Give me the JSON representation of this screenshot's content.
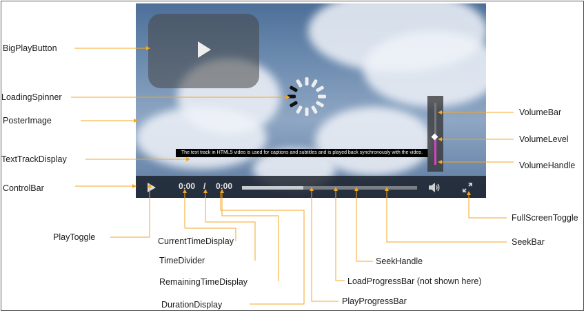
{
  "labels": {
    "big_play_button": "BigPlayButton",
    "loading_spinner": "LoadingSpinner",
    "poster_image": "PosterImage",
    "text_track_display": "TextTrackDisplay",
    "control_bar": "ControlBar",
    "play_toggle": "PlayToggle",
    "current_time_display": "CurrentTimeDisplay",
    "time_divider": "TimeDivider",
    "remaining_time_display": "RemainingTimeDisplay",
    "duration_display": "DurationDisplay",
    "play_progress_bar": "PlayProgressBar",
    "load_progress_bar": "LoadProgressBar (not shown here)",
    "seek_handle": "SeekHandle",
    "seek_bar": "SeekBar",
    "full_screen_toggle": "FullScreenToggle",
    "volume_bar": "VolumeBar",
    "volume_level": "VolumeLevel",
    "volume_handle": "VolumeHandle"
  },
  "player": {
    "caption_text": "The text track in HTML5 video is used for captions and subtitles and is played back synchronously with the video.",
    "current_time": "0:00",
    "divider": "/",
    "duration": "0:00",
    "play_progress": 0.35,
    "volume_level": 0.45
  },
  "colors": {
    "leader_line": "#f5a623",
    "volume_level": "#e040c0"
  },
  "icons": [
    "play-icon",
    "volume-icon",
    "fullscreen-icon",
    "spinner-icon"
  ]
}
